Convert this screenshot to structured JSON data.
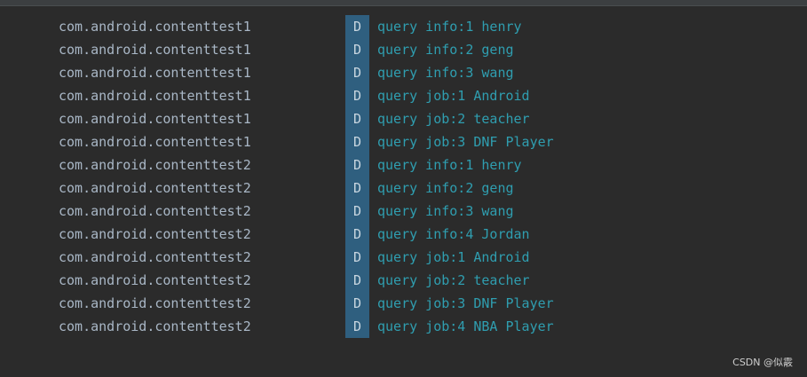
{
  "log": {
    "rows": [
      {
        "package": "com.android.contenttest1",
        "level": "D",
        "message": "query info:1 henry"
      },
      {
        "package": "com.android.contenttest1",
        "level": "D",
        "message": "query info:2 geng"
      },
      {
        "package": "com.android.contenttest1",
        "level": "D",
        "message": "query info:3 wang"
      },
      {
        "package": "com.android.contenttest1",
        "level": "D",
        "message": "query job:1 Android"
      },
      {
        "package": "com.android.contenttest1",
        "level": "D",
        "message": "query job:2 teacher"
      },
      {
        "package": "com.android.contenttest1",
        "level": "D",
        "message": "query job:3 DNF Player"
      },
      {
        "package": "com.android.contenttest2",
        "level": "D",
        "message": "query info:1 henry"
      },
      {
        "package": "com.android.contenttest2",
        "level": "D",
        "message": "query info:2 geng"
      },
      {
        "package": "com.android.contenttest2",
        "level": "D",
        "message": "query info:3 wang"
      },
      {
        "package": "com.android.contenttest2",
        "level": "D",
        "message": "query info:4 Jordan"
      },
      {
        "package": "com.android.contenttest2",
        "level": "D",
        "message": "query job:1 Android"
      },
      {
        "package": "com.android.contenttest2",
        "level": "D",
        "message": "query job:2 teacher"
      },
      {
        "package": "com.android.contenttest2",
        "level": "D",
        "message": "query job:3 DNF Player"
      },
      {
        "package": "com.android.contenttest2",
        "level": "D",
        "message": "query job:4 NBA Player"
      }
    ]
  },
  "watermark": "CSDN @似霰",
  "colors": {
    "background": "#2b2b2b",
    "package_text": "#a9b7c6",
    "level_badge": "#2f5f7f",
    "message_text": "#2f9eb0"
  }
}
